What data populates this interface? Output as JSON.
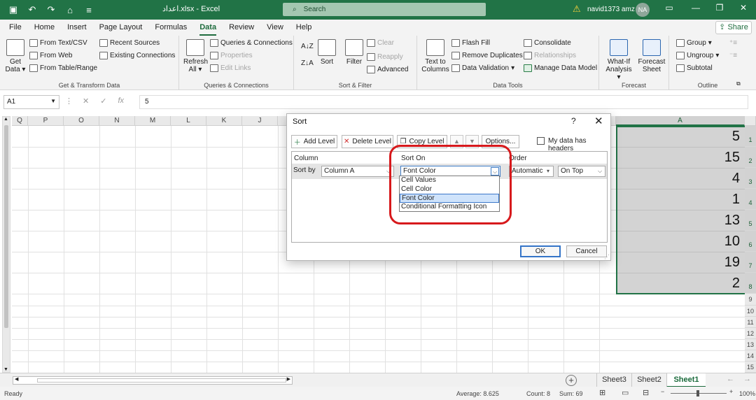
{
  "titlebar": {
    "doc_title": "اعداد.xlsx - Excel",
    "search_placeholder": "Search",
    "user_name": "navid1373 amz",
    "user_initials": "NA"
  },
  "menu": {
    "tabs": [
      "File",
      "Home",
      "Insert",
      "Page Layout",
      "Formulas",
      "Data",
      "Review",
      "View",
      "Help"
    ],
    "active_tab": "Data",
    "share_label": "Share"
  },
  "ribbon": {
    "get_transform": {
      "get_data_line1": "Get",
      "get_data_line2": "Data",
      "from_text_csv": "From Text/CSV",
      "from_web": "From Web",
      "from_table_range": "From Table/Range",
      "recent_sources": "Recent Sources",
      "existing_connections": "Existing Connections",
      "label": "Get & Transform Data"
    },
    "queries": {
      "refresh_line1": "Refresh",
      "refresh_line2": "All",
      "queries_connections": "Queries & Connections",
      "properties": "Properties",
      "edit_links": "Edit Links",
      "label": "Queries & Connections"
    },
    "sort_filter": {
      "sort": "Sort",
      "filter": "Filter",
      "clear": "Clear",
      "reapply": "Reapply",
      "advanced": "Advanced",
      "label": "Sort & Filter"
    },
    "data_tools": {
      "text_to_columns_line1": "Text to",
      "text_to_columns_line2": "Columns",
      "flash_fill": "Flash Fill",
      "remove_duplicates": "Remove Duplicates",
      "data_validation": "Data Validation",
      "consolidate": "Consolidate",
      "relationships": "Relationships",
      "manage_data_model": "Manage Data Model",
      "label": "Data Tools"
    },
    "forecast": {
      "what_if_line1": "What-If",
      "what_if_line2": "Analysis",
      "forecast_sheet_line1": "Forecast",
      "forecast_sheet_line2": "Sheet",
      "label": "Forecast"
    },
    "outline": {
      "group": "Group",
      "ungroup": "Ungroup",
      "subtotal": "Subtotal",
      "label": "Outline"
    }
  },
  "formula_bar": {
    "name_box": "A1",
    "value": "5"
  },
  "grid": {
    "column_headers": [
      "Q",
      "P",
      "O",
      "N",
      "M",
      "L",
      "K",
      "J",
      "A"
    ],
    "row_numbers": [
      "1",
      "2",
      "3",
      "4",
      "5",
      "6",
      "7",
      "8",
      "9",
      "10",
      "11",
      "12",
      "13",
      "14",
      "15"
    ],
    "column_a_values": [
      "5",
      "15",
      "4",
      "1",
      "13",
      "10",
      "19",
      "2"
    ]
  },
  "sheets": {
    "tabs": [
      "Sheet3",
      "Sheet2",
      "Sheet1"
    ],
    "active": "Sheet1"
  },
  "status": {
    "ready": "Ready",
    "average": "Average: 8.625",
    "count": "Count: 8",
    "sum": "Sum: 69",
    "zoom": "100%"
  },
  "sort_dialog": {
    "title": "Sort",
    "help": "?",
    "add_level": "Add Level",
    "delete_level": "Delete Level",
    "copy_level": "Copy Level",
    "options": "Options...",
    "my_data_has_headers": "My data has headers",
    "col_header_column": "Column",
    "col_header_sort_on": "Sort On",
    "col_header_order": "Order",
    "sort_by_label": "Sort by",
    "column_value": "Column A",
    "sort_on_value": "Font Color",
    "order_color_value": "Automatic",
    "order_position_value": "On Top",
    "sort_on_options": [
      "Cell Values",
      "Cell Color",
      "Font Color",
      "Conditional Formatting Icon"
    ],
    "selected_option": "Font Color",
    "ok": "OK",
    "cancel": "Cancel",
    "highlight_color": "#d7191c"
  }
}
